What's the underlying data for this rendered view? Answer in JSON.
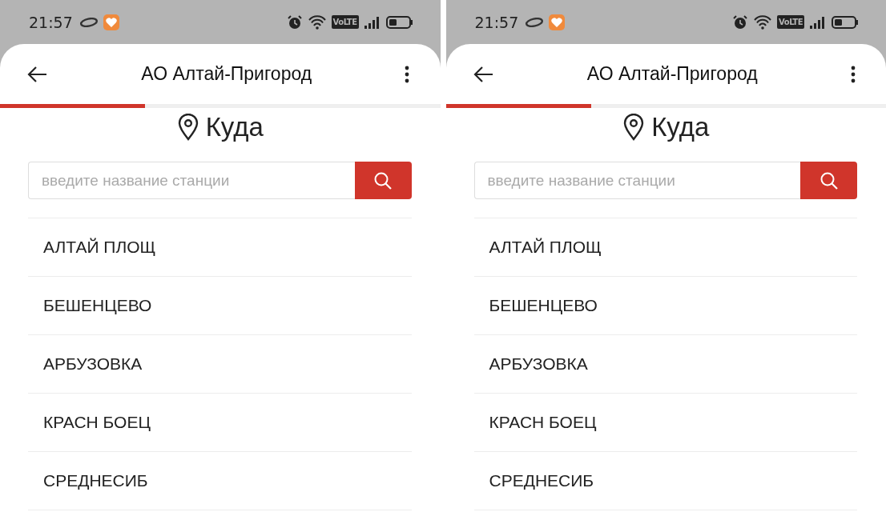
{
  "screens": [
    {
      "status_bar": {
        "time": "21:57",
        "network_badge": "VoLTE"
      },
      "title": "АО Алтай-Пригород",
      "progress": {
        "level": 0.33
      },
      "heading": "Куда",
      "search": {
        "placeholder": "введите название станции"
      },
      "stations": [
        "АЛТАЙ ПЛОЩ",
        "БЕШЕНЦЕВО",
        "АРБУЗОВКА",
        "КРАСН БОЕЦ",
        "СРЕДНЕСИБ"
      ]
    },
    {
      "status_bar": {
        "time": "21:57",
        "network_badge": "VoLTE"
      },
      "title": "АО Алтай-Пригород",
      "progress": {
        "level": 0.33
      },
      "heading": "Куда",
      "search": {
        "placeholder": "введите название станции"
      },
      "stations": [
        "АЛТАЙ ПЛОЩ",
        "БЕШЕНЦЕВО",
        "АРБУЗОВКА",
        "КРАСН БОЕЦ",
        "СРЕДНЕСИБ"
      ]
    }
  ]
}
